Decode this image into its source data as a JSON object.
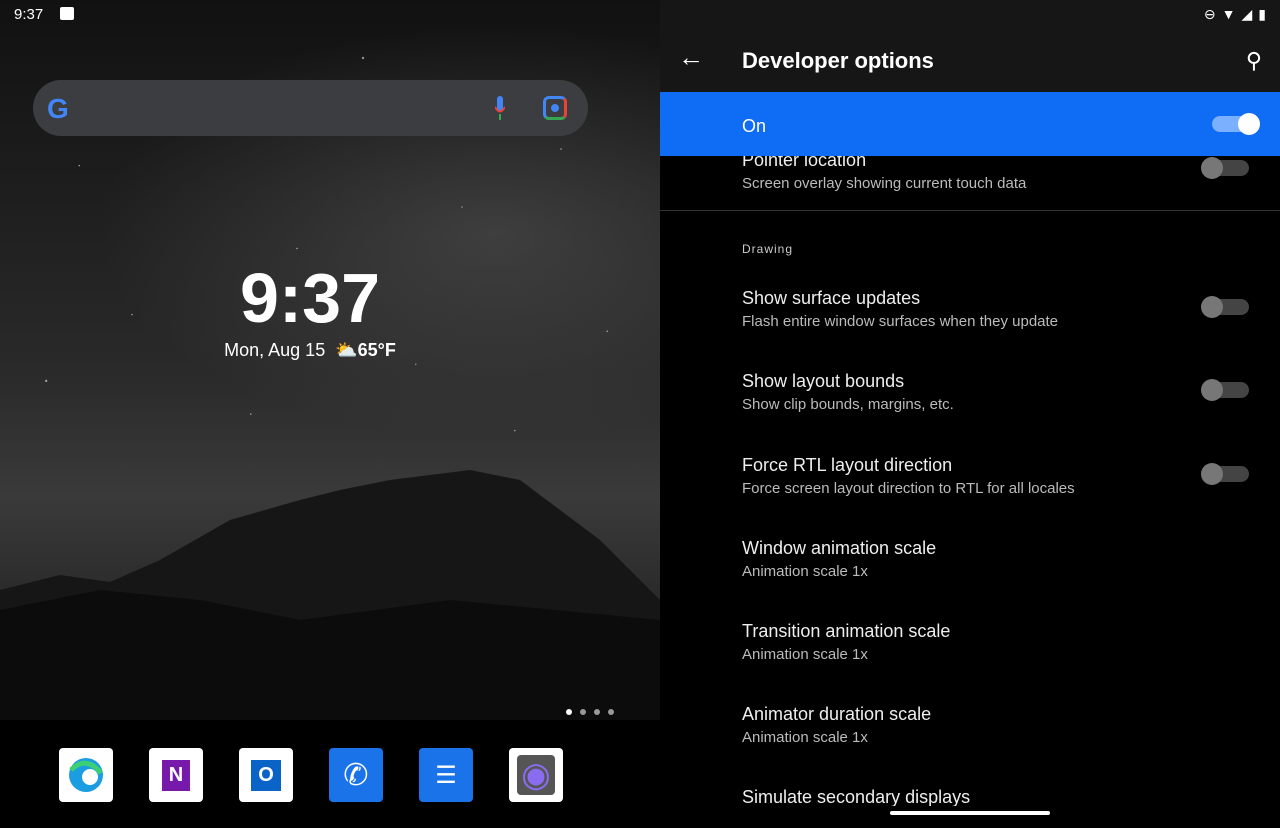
{
  "home": {
    "status_time": "9:37",
    "status_icons": [
      "image-notification-icon"
    ],
    "search": {
      "icons": [
        "google-logo",
        "mic-icon",
        "lens-icon"
      ],
      "logo_letter": "G"
    },
    "clock": "9:37",
    "date": "Mon, Aug 15",
    "weather_icon": "partly-cloudy-icon",
    "temperature": "65°F",
    "page_count": 4,
    "current_page": 1,
    "dock": [
      {
        "name": "Microsoft Edge",
        "icon": "edge-icon"
      },
      {
        "name": "OneNote",
        "icon": "onenote-icon",
        "glyph": "N"
      },
      {
        "name": "Outlook",
        "icon": "outlook-icon",
        "glyph": "O"
      },
      {
        "name": "Phone",
        "icon": "phone-icon",
        "glyph": "✆"
      },
      {
        "name": "Messages",
        "icon": "messages-icon",
        "glyph": "☰"
      },
      {
        "name": "Camera",
        "icon": "camera-icon",
        "glyph": "◉"
      }
    ]
  },
  "settings": {
    "status_icons": [
      "do-not-disturb-icon",
      "wifi-icon",
      "no-signal-icon",
      "battery-icon"
    ],
    "title": "Developer options",
    "master": {
      "label": "On",
      "checked": true
    },
    "accent": "#0f6cf5",
    "items_top": [
      {
        "title": "Pointer location",
        "subtitle": "Screen overlay showing current touch data",
        "checked": false
      }
    ],
    "category": "Drawing",
    "items": [
      {
        "title": "Show surface updates",
        "subtitle": "Flash entire window surfaces when they update",
        "toggle": true,
        "checked": false
      },
      {
        "title": "Show layout bounds",
        "subtitle": "Show clip bounds, margins, etc.",
        "toggle": true,
        "checked": false
      },
      {
        "title": "Force RTL layout direction",
        "subtitle": "Force screen layout direction to RTL for all locales",
        "toggle": true,
        "checked": false
      },
      {
        "title": "Window animation scale",
        "subtitle": "Animation scale 1x"
      },
      {
        "title": "Transition animation scale",
        "subtitle": "Animation scale 1x"
      },
      {
        "title": "Animator duration scale",
        "subtitle": "Animation scale 1x"
      },
      {
        "title": "Simulate secondary displays",
        "subtitle": ""
      }
    ]
  }
}
